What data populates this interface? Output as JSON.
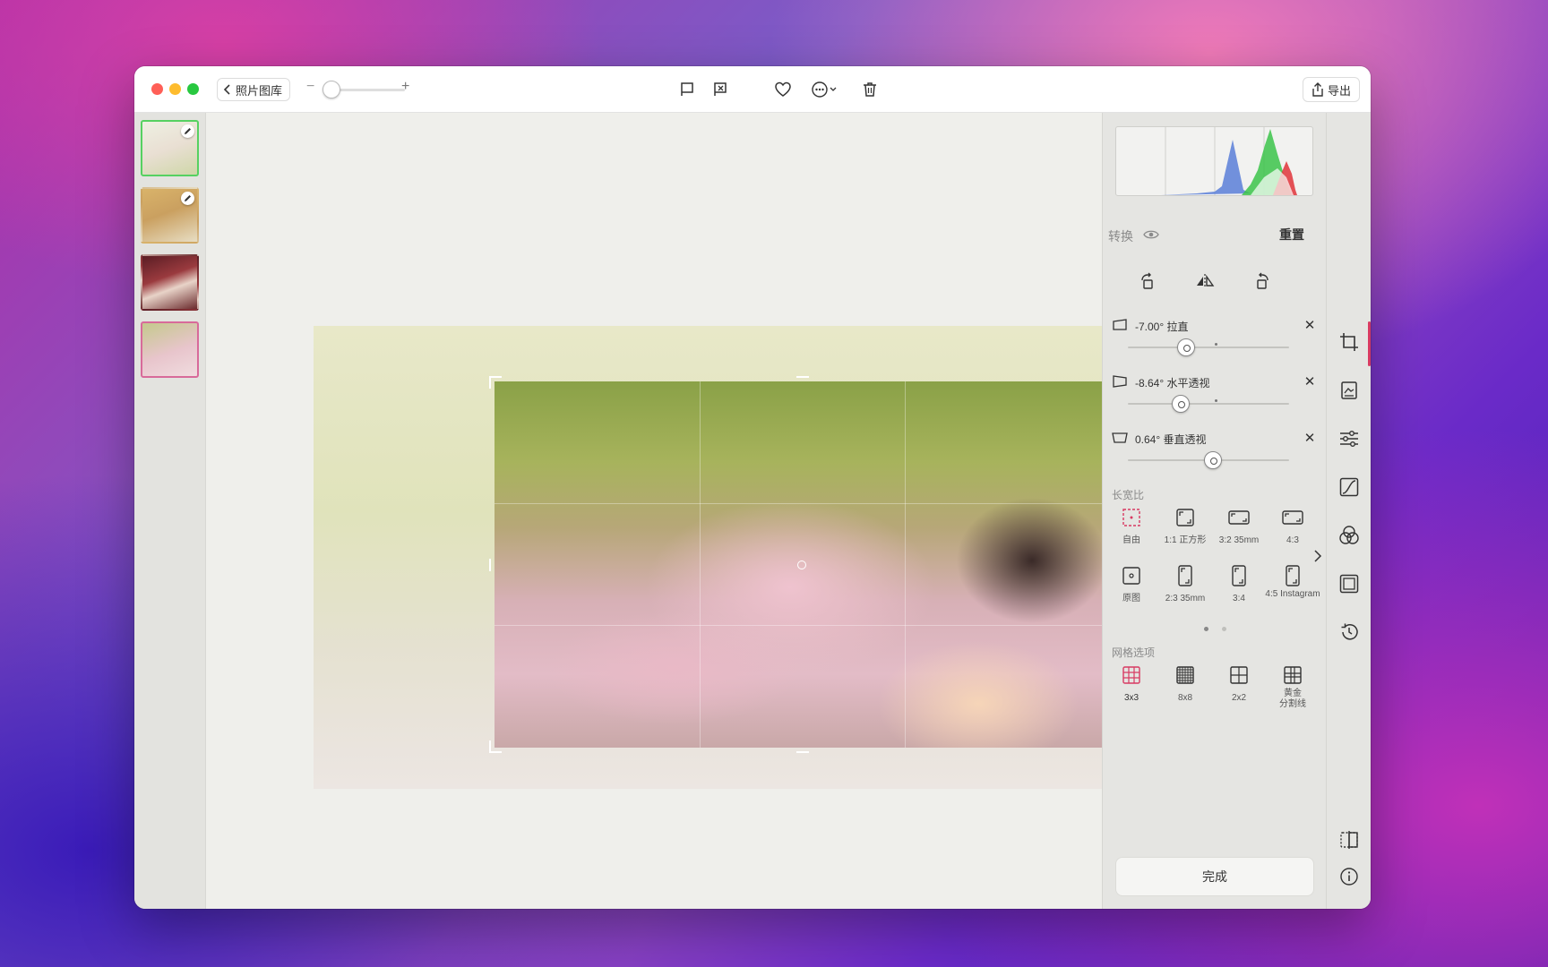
{
  "titlebar": {
    "back_label": "照片图库",
    "export_label": "导出",
    "zoom_minus": "−",
    "zoom_plus": "+"
  },
  "filmstrip": {
    "thumbs": [
      {
        "name": "thumb-1",
        "edited": true,
        "selected": false
      },
      {
        "name": "thumb-2",
        "edited": true,
        "selected": false
      },
      {
        "name": "thumb-3",
        "edited": false,
        "selected": false
      },
      {
        "name": "thumb-4",
        "edited": false,
        "selected": true
      }
    ]
  },
  "panel": {
    "section_transform": "转换",
    "reset_label": "重置",
    "adjustments": [
      {
        "value": "-7.00° 拉直",
        "level": 0.36
      },
      {
        "value": "-8.64° 水平透视",
        "level": 0.33
      },
      {
        "value": "0.64° 垂直透视",
        "level": 0.53
      }
    ],
    "aspect_label": "长宽比",
    "aspect_options": [
      {
        "label": "自由",
        "active": true
      },
      {
        "label": "1:1 正方形",
        "active": false
      },
      {
        "label": "3:2 35mm",
        "active": false
      },
      {
        "label": "4:3",
        "active": false
      },
      {
        "label": "原图",
        "active": false
      },
      {
        "label": "2:3 35mm",
        "active": false
      },
      {
        "label": "3:4",
        "active": false
      },
      {
        "label": "4:5 Instagram",
        "active": false
      }
    ],
    "grid_label": "网格选项",
    "grid_options": [
      {
        "label": "3x3",
        "active": true
      },
      {
        "label": "8x8",
        "active": false
      },
      {
        "label": "2x2",
        "active": false
      },
      {
        "label": "黄金\n分割线",
        "active": false
      }
    ],
    "done_label": "完成",
    "pager": {
      "pages": 2,
      "current": 1
    }
  },
  "toolstrip": {
    "icons": [
      "crop-icon",
      "image-adjust-icon",
      "sliders-icon",
      "curves-icon",
      "color-mixer-icon",
      "frame-icon",
      "history-icon",
      "compare-icon",
      "info-icon"
    ],
    "active": "crop-icon"
  },
  "colors": {
    "accent": "#d83a62",
    "close_red": "#ff5f57",
    "minimize_yellow": "#febc2e",
    "zoom_green": "#28c840"
  }
}
